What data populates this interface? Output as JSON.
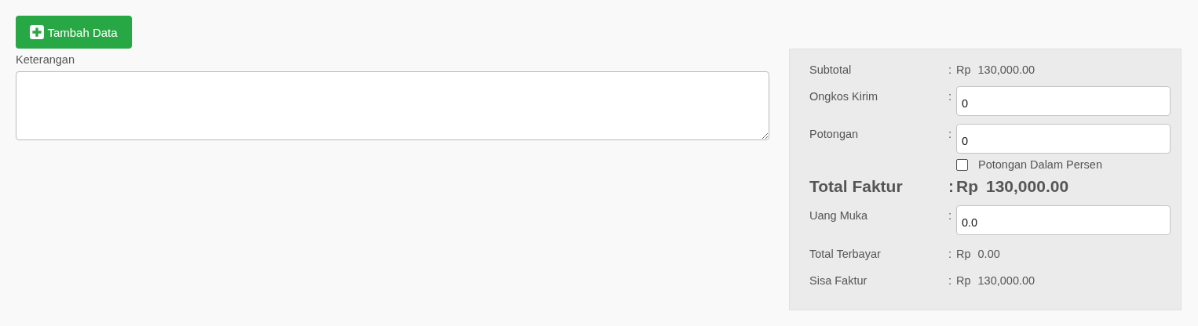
{
  "add_button": {
    "label": "Tambah Data"
  },
  "notes": {
    "label": "Keterangan"
  },
  "summary": [
    {
      "kind": "text",
      "label": "Subtotal",
      "colon": ":",
      "currency": "Rp",
      "value": "130,000.00"
    },
    {
      "kind": "input",
      "label": "Ongkos Kirim",
      "colon": ":",
      "value": "0"
    },
    {
      "kind": "input",
      "label": "Potongan",
      "colon": ":",
      "value": "0",
      "option": {
        "label": "Potongan Dalam Persen",
        "checked": false
      }
    },
    {
      "kind": "total",
      "label": "Total Faktur",
      "colon": ":",
      "currency": "Rp",
      "value": "130,000.00"
    },
    {
      "kind": "input",
      "label": "Uang Muka",
      "colon": ":",
      "value": "0.0"
    },
    {
      "kind": "text",
      "label": "Total Terbayar",
      "colon": ":",
      "currency": "Rp",
      "value": "0.00"
    },
    {
      "kind": "text",
      "label": "Sisa Faktur",
      "colon": ":",
      "currency": "Rp",
      "value": "130,000.00"
    }
  ]
}
